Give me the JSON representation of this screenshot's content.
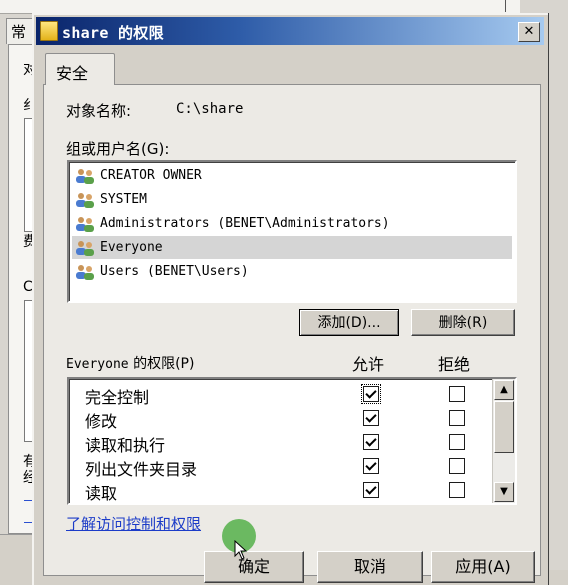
{
  "background_window": {
    "tab_label": "常",
    "side_chars": [
      "对",
      "纟",
      "费",
      "C",
      "有",
      "经"
    ]
  },
  "dialog": {
    "title": "share 的权限",
    "close_label": "✕",
    "tab_label": "安全",
    "object_name_label": "对象名称:",
    "object_name_value": "C:\\share",
    "group_label": "组或用户名(G):",
    "users": [
      {
        "label": "CREATOR OWNER",
        "selected": false
      },
      {
        "label": "SYSTEM",
        "selected": false
      },
      {
        "label": "Administrators (BENET\\Administrators)",
        "selected": false
      },
      {
        "label": "Everyone",
        "selected": true
      },
      {
        "label": "Users (BENET\\Users)",
        "selected": false
      }
    ],
    "add_button": "添加(D)...",
    "remove_button": "删除(R)",
    "perm_header_user": "Everyone",
    "perm_header_suffix": " 的权限(P)",
    "allow_header": "允许",
    "deny_header": "拒绝",
    "permissions": [
      {
        "name": "完全控制",
        "allow": true,
        "deny": false
      },
      {
        "name": "修改",
        "allow": true,
        "deny": false
      },
      {
        "name": "读取和执行",
        "allow": true,
        "deny": false
      },
      {
        "name": "列出文件夹目录",
        "allow": true,
        "deny": false
      },
      {
        "name": "读取",
        "allow": true,
        "deny": false
      }
    ],
    "learn_link": "了解访问控制和权限",
    "ok_button": "确定",
    "cancel_button": "取消",
    "apply_button": "应用(A)"
  },
  "colors": {
    "title_bar_start": "#0a246a",
    "title_bar_end": "#a6caf0",
    "link": "#1c3cc8",
    "click_marker": "#46aa3c"
  },
  "icons": {
    "title": "folder-icon",
    "user": "users-group-icon",
    "close": "close-icon",
    "scroll_up": "scroll-up-arrow-icon",
    "scroll_down": "scroll-down-arrow-icon",
    "cursor": "mouse-cursor-icon"
  }
}
